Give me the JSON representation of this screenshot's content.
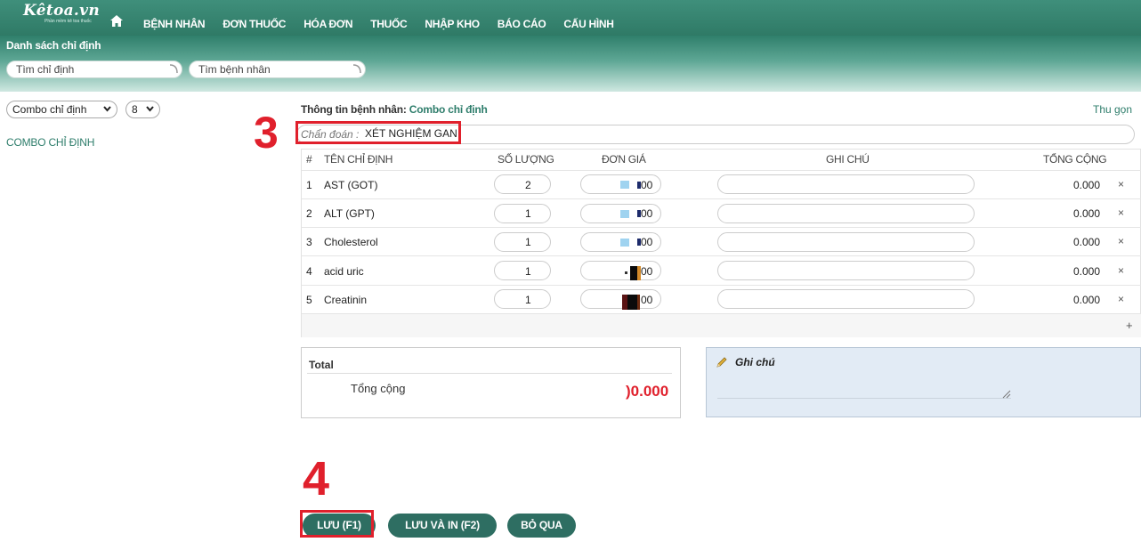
{
  "brand": {
    "name": "Kêtoa.vn",
    "tagline": "Phần mềm kê toa thuốc"
  },
  "nav": {
    "items": [
      "BỆNH NHÂN",
      "ĐƠN THUỐC",
      "HÓA ĐƠN",
      "THUỐC",
      "NHẬP KHO",
      "BÁO CÁO",
      "CẤU HÌNH"
    ]
  },
  "page": {
    "title": "Danh sách chỉ định",
    "search_orders_placeholder": "Tìm chỉ định",
    "search_patient_placeholder": "Tìm bệnh nhân"
  },
  "sidebar": {
    "type_select": "Combo chỉ định",
    "count_select": "8",
    "combo_label": "COMBO CHỈ ĐỊNH"
  },
  "main": {
    "patient_info_label": "Thông tin bệnh nhân:",
    "patient_info_value": "Combo chỉ định",
    "collapse": "Thu gọn",
    "diagnosis_label": "Chẩn đoán :",
    "diagnosis_value": "XÉT NGHIỆM GAN",
    "step_3": "3",
    "step_4": "4"
  },
  "table": {
    "headers": {
      "index": "#",
      "name": "TÊN CHỈ ĐỊNH",
      "qty": "SỐ LƯỢNG",
      "price": "ĐƠN GIÁ",
      "note": "GHI CHÚ",
      "total": "TỔNG CỘNG"
    },
    "rows": [
      {
        "index": "1",
        "name": "AST (GOT)",
        "qty": "2",
        "price_suffix": "00",
        "total": "0.000"
      },
      {
        "index": "2",
        "name": "ALT (GPT)",
        "qty": "1",
        "price_suffix": "00",
        "total": "0.000"
      },
      {
        "index": "3",
        "name": "Cholesterol",
        "qty": "1",
        "price_suffix": "00",
        "total": "0.000"
      },
      {
        "index": "4",
        "name": "acid uric",
        "qty": "1",
        "price_suffix": "00",
        "total": "0.000"
      },
      {
        "index": "5",
        "name": "Creatinin",
        "qty": "1",
        "price_suffix": "00",
        "total": "0.000"
      }
    ],
    "delete_symbol": "×",
    "add_symbol": "+"
  },
  "summary": {
    "title": "Total",
    "label": "Tổng cộng",
    "value": ")0.000"
  },
  "note_panel": {
    "title": "Ghi chú"
  },
  "buttons": {
    "save": "LƯU (F1)",
    "save_print": "LƯU VÀ IN (F2)",
    "skip": "BỎ QUA"
  },
  "colors": {
    "brand": "#2e7d6b",
    "accent_red": "#e0202c",
    "button": "#2e6e62"
  }
}
